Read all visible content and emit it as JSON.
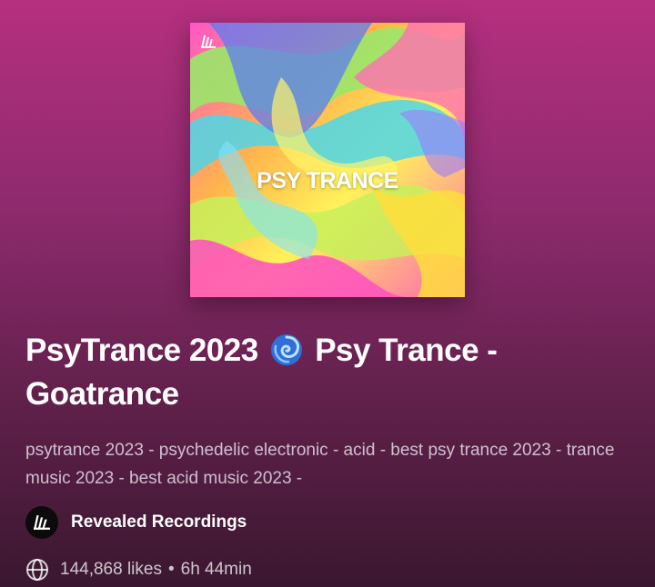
{
  "playlist": {
    "cover_text": "PSY TRANCE",
    "title_part1": "PsyTrance 2023",
    "title_part2": "Psy Trance -",
    "title_part3": "Goatrance",
    "description": "psytrance 2023 - psychedelic electronic - acid - best psy trance 2023 - trance music 2023 - best acid music 2023 -",
    "owner": "Revealed Recordings",
    "likes": "144,868 likes",
    "duration": "6h 44min",
    "separator": "•"
  },
  "icons": {
    "cover_logo": "revealed-logo-icon",
    "title_emoji": "cyclone-spiral-icon",
    "owner_avatar": "revealed-logo-icon",
    "meta": "globe-icon"
  },
  "colors": {
    "background_top": "#b5307f",
    "background_bottom": "#3a1730"
  }
}
